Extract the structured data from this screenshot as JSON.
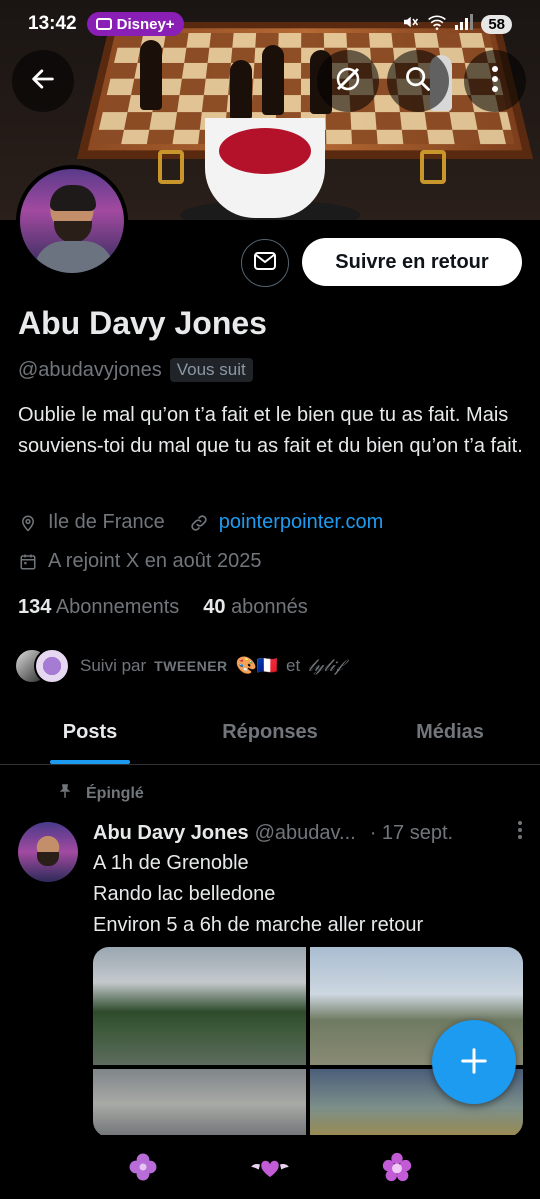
{
  "status_bar": {
    "time": "13:42",
    "app_pill": "Disney+",
    "battery": "58"
  },
  "profile": {
    "name": "Abu Davy Jones",
    "handle": "@abudavyjones",
    "follows_you": "Vous suit",
    "bio": "Oublie le mal qu’on t’a fait et le bien que tu as fait. Mais souviens-toi du mal que tu as fait et du bien qu’on t’a fait.",
    "location": "Ile de France",
    "website": "pointerpointer.com",
    "joined": "A rejoint X en août 2025",
    "following_count": "134",
    "following_label": "Abonnements",
    "followers_count": "40",
    "followers_label": "abonnés",
    "followed_by_prefix": "Suivi par",
    "followed_by_user1": "TWEENER",
    "followed_by_emoji": "🎨🇫🇷",
    "followed_by_and": "et",
    "followed_by_user2": "𝓁𝓎𝓁𝒾𝒻"
  },
  "actions": {
    "follow_back": "Suivre en retour"
  },
  "tabs": [
    {
      "label": "Posts"
    },
    {
      "label": "Réponses"
    },
    {
      "label": "Médias"
    }
  ],
  "post": {
    "pinned_label": "Épinglé",
    "author_name": "Abu Davy Jones",
    "author_handle": "@abudav...",
    "date": "· 17 sept.",
    "lines": [
      "A 1h de Grenoble",
      "Rando lac belledone",
      "Environ 5 a 6h de marche aller retour"
    ]
  },
  "colors": {
    "accent": "#1d9bf0",
    "background": "#000000",
    "pill": "#8a1fb5"
  },
  "icons": {
    "bottom_nav": [
      "flower-clover-icon",
      "heart-wings-icon",
      "flower-icon"
    ]
  }
}
